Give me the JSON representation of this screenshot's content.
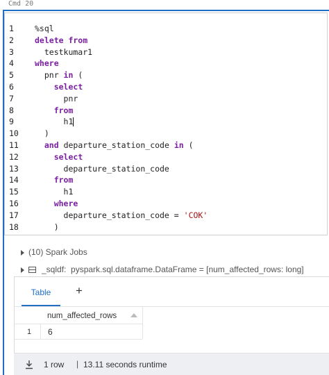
{
  "cell": {
    "label": "Cmd 20"
  },
  "editor": {
    "line_numbers": [
      "1",
      "2",
      "3",
      "4",
      "5",
      "6",
      "7",
      "8",
      "9",
      "10",
      "11",
      "12",
      "13",
      "14",
      "15",
      "16",
      "17",
      "18"
    ],
    "lines": [
      [
        {
          "t": "%sql",
          "c": "plain"
        }
      ],
      [
        {
          "t": "delete from",
          "c": "kw"
        }
      ],
      [
        {
          "t": "  testkumar1",
          "c": "plain"
        }
      ],
      [
        {
          "t": "where",
          "c": "kw"
        }
      ],
      [
        {
          "t": "  pnr ",
          "c": "plain"
        },
        {
          "t": "in",
          "c": "kw"
        },
        {
          "t": " (",
          "c": "plain"
        }
      ],
      [
        {
          "t": "    ",
          "c": "plain"
        },
        {
          "t": "select",
          "c": "kw"
        }
      ],
      [
        {
          "t": "      pnr",
          "c": "plain"
        }
      ],
      [
        {
          "t": "    ",
          "c": "plain"
        },
        {
          "t": "from",
          "c": "kw"
        }
      ],
      [
        {
          "t": "      h1",
          "c": "plain"
        },
        {
          "t": "",
          "c": "cursor"
        }
      ],
      [
        {
          "t": "  )",
          "c": "plain"
        }
      ],
      [
        {
          "t": "  ",
          "c": "plain"
        },
        {
          "t": "and",
          "c": "kw"
        },
        {
          "t": " departure_station_code ",
          "c": "plain"
        },
        {
          "t": "in",
          "c": "kw"
        },
        {
          "t": " (",
          "c": "plain"
        }
      ],
      [
        {
          "t": "    ",
          "c": "plain"
        },
        {
          "t": "select",
          "c": "kw"
        }
      ],
      [
        {
          "t": "      departure_station_code",
          "c": "plain"
        }
      ],
      [
        {
          "t": "    ",
          "c": "plain"
        },
        {
          "t": "from",
          "c": "kw"
        }
      ],
      [
        {
          "t": "      h1",
          "c": "plain"
        }
      ],
      [
        {
          "t": "    ",
          "c": "plain"
        },
        {
          "t": "where",
          "c": "kw"
        }
      ],
      [
        {
          "t": "      departure_station_code = ",
          "c": "plain"
        },
        {
          "t": "'COK'",
          "c": "str"
        }
      ],
      [
        {
          "t": "    )",
          "c": "plain"
        }
      ]
    ]
  },
  "output": {
    "spark_jobs": "(10) Spark Jobs",
    "dataframe_name": "_sqldf:",
    "dataframe_type": "pyspark.sql.dataframe.DataFrame = [num_affected_rows: long]"
  },
  "results": {
    "tab_label": "Table",
    "add_label": "+",
    "columns": [
      "num_affected_rows"
    ],
    "rows": [
      {
        "index": "1",
        "values": [
          "6"
        ]
      }
    ]
  },
  "footer": {
    "row_count": "1 row",
    "separator": "|",
    "runtime": "13.11 seconds runtime"
  },
  "colors": {
    "accent": "#1f6fc5",
    "keyword": "#7a1fa2",
    "string": "#a31515"
  }
}
